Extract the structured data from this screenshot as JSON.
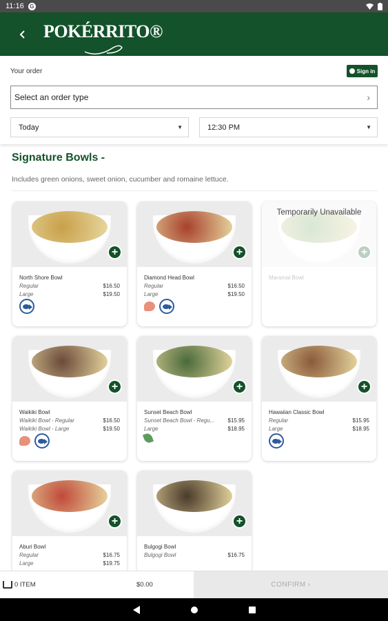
{
  "status": {
    "time": "11:16",
    "g": "G"
  },
  "app": {
    "logo": "POKÉRRITO®"
  },
  "order": {
    "label": "Your order",
    "sign_in": "Sign in",
    "order_type_placeholder": "Select an order type",
    "date": "Today",
    "time": "12:30 PM"
  },
  "section": {
    "title": "Signature Bowls  -",
    "description": "Includes green onions, sweet onion, cucumber and romaine lettuce."
  },
  "cards": [
    {
      "name": "North Shore Bowl",
      "rows": [
        {
          "label": "Regular",
          "price": "$16.50"
        },
        {
          "label": "Large",
          "price": "$19.50"
        }
      ],
      "icons": [
        "fish-icon"
      ],
      "available": true,
      "food_color": "#c8a04a"
    },
    {
      "name": "Diamond Head Bowl",
      "rows": [
        {
          "label": "Regular",
          "price": "$16.50"
        },
        {
          "label": "Large",
          "price": "$19.50"
        }
      ],
      "icons": [
        "shrimp-icon",
        "fish-icon"
      ],
      "available": true,
      "food_color": "#a8412e"
    },
    {
      "name": "Maramal Bowl",
      "rows": [],
      "icons": [],
      "available": false,
      "unavailable_text": "Temporarily Unavailable",
      "food_color": "#7aa86a"
    },
    {
      "name": "Waikiki Bowl",
      "rows": [
        {
          "label": "Waikiki Bowl - Regular",
          "price": "$16.50"
        },
        {
          "label": "Waikiki Bowl - Large",
          "price": "$19.50"
        }
      ],
      "icons": [
        "shrimp-icon",
        "fish-icon"
      ],
      "available": true,
      "food_color": "#6b4a3a"
    },
    {
      "name": "Sunset Beach Bowl",
      "rows": [
        {
          "label": "Sunset Beach Bowl - Regu...",
          "price": "$15.95"
        },
        {
          "label": "Large",
          "price": "$18.95"
        }
      ],
      "icons": [
        "leaf-icon"
      ],
      "available": true,
      "food_color": "#4a6a3a"
    },
    {
      "name": "Hawaiian Classic Bowl",
      "rows": [
        {
          "label": "Regular",
          "price": "$15.95"
        },
        {
          "label": "Large",
          "price": "$18.95"
        }
      ],
      "icons": [
        "fish-icon"
      ],
      "available": true,
      "food_color": "#8a5a3a"
    },
    {
      "name": "Aburi Bowl",
      "rows": [
        {
          "label": "Regular",
          "price": "$16.75"
        },
        {
          "label": "Large",
          "price": "$19.75"
        }
      ],
      "icons": [],
      "available": true,
      "food_color": "#c04a3a"
    },
    {
      "name": "Bulgogi Bowl",
      "rows": [
        {
          "label": "Bulgogi Bowl",
          "price": "$16.75"
        }
      ],
      "icons": [],
      "available": true,
      "food_color": "#4a3a2a"
    }
  ],
  "cart": {
    "items": "0 ITEM",
    "total": "$0.00",
    "confirm": "CONFIRM  ›"
  },
  "colors": {
    "brand": "#13522a"
  }
}
